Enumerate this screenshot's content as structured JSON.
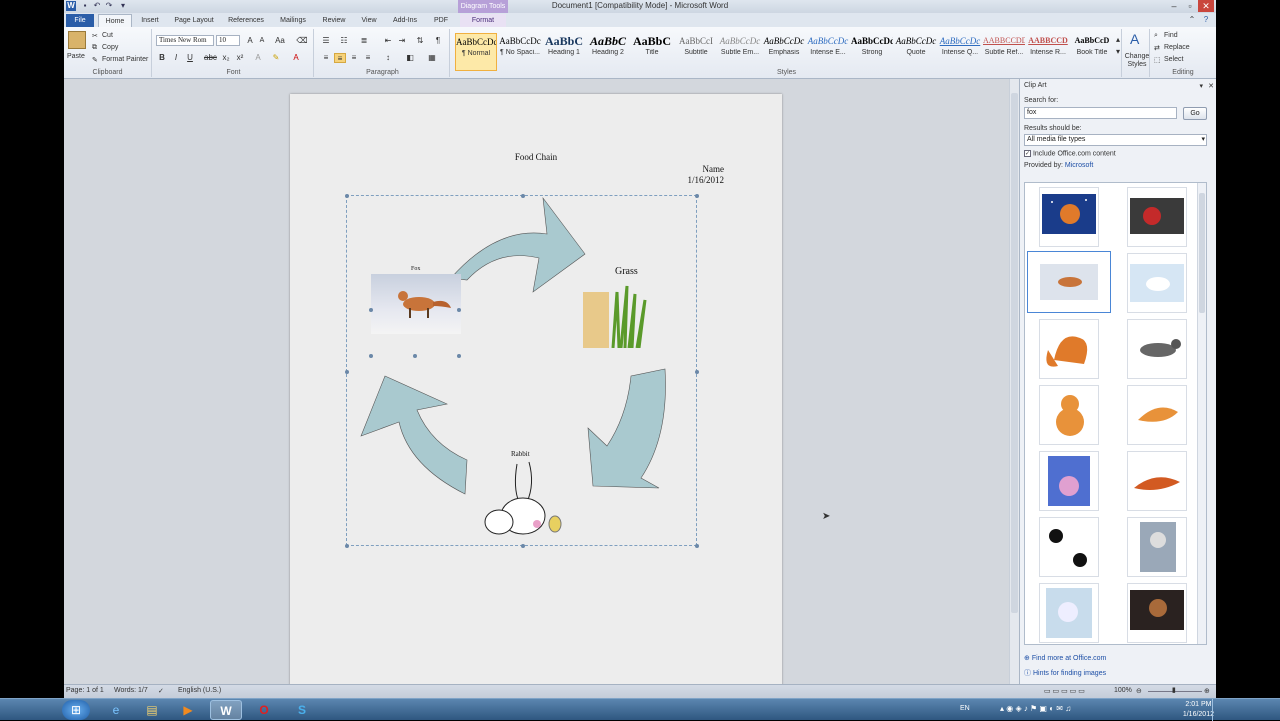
{
  "window": {
    "title": "Document1 [Compatibility Mode] - Microsoft Word",
    "context_tab": "Diagram Tools"
  },
  "tabs": [
    "File",
    "Home",
    "Insert",
    "Page Layout",
    "References",
    "Mailings",
    "Review",
    "View",
    "Add-Ins",
    "PDF",
    "Format"
  ],
  "ribbon": {
    "clipboard": {
      "paste": "Paste",
      "cut": "Cut",
      "copy": "Copy",
      "format_painter": "Format Painter",
      "label": "Clipboard"
    },
    "font": {
      "name": "Times New Rom",
      "size": "10",
      "label": "Font"
    },
    "paragraph": {
      "label": "Paragraph"
    },
    "styles": {
      "label": "Styles",
      "items": [
        {
          "preview": "AaBbCcDc",
          "name": "¶ Normal"
        },
        {
          "preview": "AaBbCcDc",
          "name": "¶ No Spaci..."
        },
        {
          "preview": "AaBbC",
          "name": "Heading 1"
        },
        {
          "preview": "AaBbC",
          "name": "Heading 2"
        },
        {
          "preview": "AaBbC",
          "name": "Title"
        },
        {
          "preview": "AaBbCcI",
          "name": "Subtitle"
        },
        {
          "preview": "AaBbCcDc",
          "name": "Subtle Em..."
        },
        {
          "preview": "AaBbCcDc",
          "name": "Emphasis"
        },
        {
          "preview": "AaBbCcDc",
          "name": "Intense E..."
        },
        {
          "preview": "AaBbCcDd",
          "name": "Strong"
        },
        {
          "preview": "AaBbCcDc",
          "name": "Quote"
        },
        {
          "preview": "AaBbCcDc",
          "name": "Intense Q..."
        },
        {
          "preview": "AABBCCDD",
          "name": "Subtle Ref..."
        },
        {
          "preview": "AABBCCD",
          "name": "Intense R..."
        },
        {
          "preview": "AaBbCcD",
          "name": "Book Title"
        }
      ],
      "change_styles": "Change Styles"
    },
    "editing": {
      "find": "Find",
      "replace": "Replace",
      "select": "Select",
      "label": "Editing"
    }
  },
  "document": {
    "heading": "Food Chain",
    "name": "Name",
    "date": "1/16/2012",
    "labels": {
      "fox": "Fox",
      "grass": "Grass",
      "rabbit": "Rabbit"
    }
  },
  "clipart": {
    "title": "Clip Art",
    "search_label": "Search for:",
    "search_value": "fox",
    "go": "Go",
    "results_label": "Results should be:",
    "media_type": "All media file types",
    "include_office": "Include Office.com content",
    "provided_by": "Provided by:",
    "provider": "Microsoft",
    "find_more": "Find more at Office.com",
    "hints": "Hints for finding images"
  },
  "status": {
    "page": "Page: 1 of 1",
    "words": "Words: 1/7",
    "language": "English (U.S.)",
    "zoom": "100%"
  },
  "taskbar": {
    "lang": "EN",
    "time": "2:01 PM",
    "date": "1/16/2012"
  },
  "colors": {
    "accent": "#2a5da8",
    "arrow_fill": "#a9c9cf",
    "arrow_stroke": "#555555"
  }
}
